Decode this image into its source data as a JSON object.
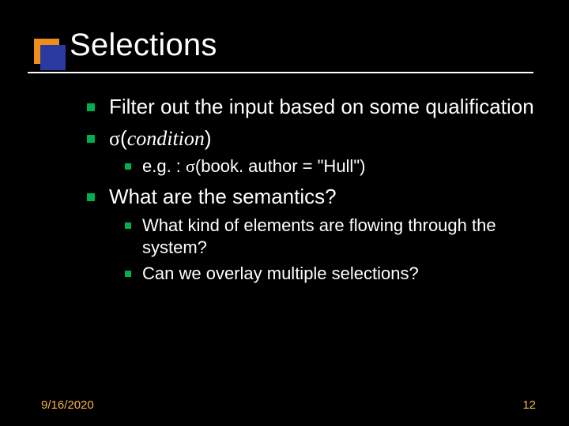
{
  "slide": {
    "title": "Selections",
    "bullets": [
      {
        "text": "Filter out the input based on some qualification"
      },
      {
        "sigma": "σ",
        "arg_open": "(",
        "arg": "condition",
        "arg_close": ")",
        "children": [
          {
            "prefix": "e.g. : ",
            "sigma": "σ",
            "rest": "(book. author = \"Hull\")"
          }
        ]
      },
      {
        "text": "What are the semantics?",
        "children": [
          {
            "text": "What kind of elements are flowing through the system?"
          },
          {
            "text": "Can we overlay multiple selections?"
          }
        ]
      }
    ]
  },
  "footer": {
    "date": "9/16/2020",
    "page": "12"
  }
}
